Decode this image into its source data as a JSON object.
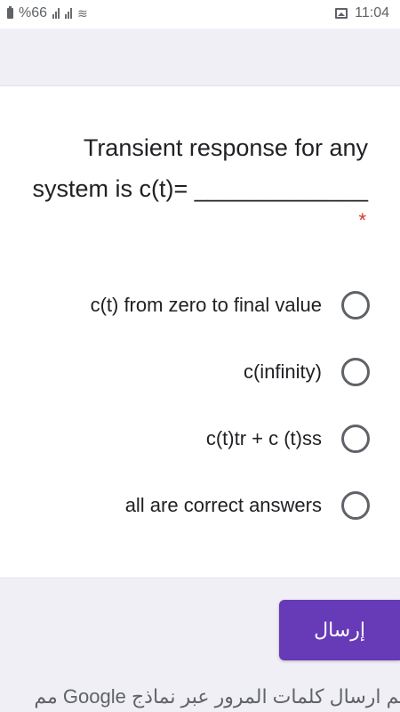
{
  "status_bar": {
    "battery_text": "%66",
    "time": "11:04"
  },
  "question": {
    "line1": "Transient response for any",
    "line2": "_____________ =system is c(t)",
    "required_mark": "*"
  },
  "options": [
    {
      "label": "c(t) from zero to final value"
    },
    {
      "label": "c(infinity)"
    },
    {
      "label": "c(t)tr + c (t)ss"
    },
    {
      "label": "all are correct answers"
    }
  ],
  "submit": {
    "label": "إرسال"
  },
  "footer": {
    "text": "لم ارسال كلمات المرور عبر نماذج Google مم"
  },
  "colors": {
    "accent": "#673ab7",
    "required": "#d93025"
  }
}
